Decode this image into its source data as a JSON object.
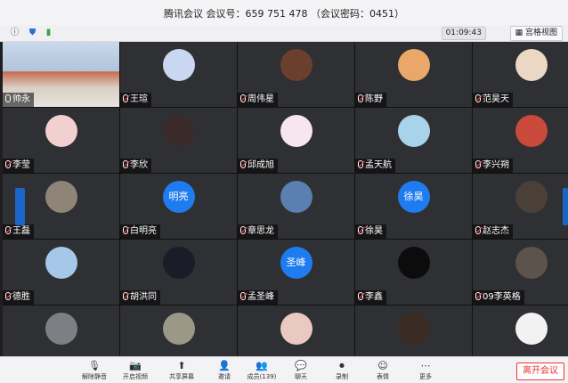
{
  "window": {
    "title": "腾讯会议 会议号：659 751 478 （会议密码：0451）"
  },
  "toolbar": {
    "timer": "01:09:43",
    "view_label": "宫格视图"
  },
  "tiles": [
    {
      "name": "帅永",
      "kind": "video"
    },
    {
      "name": "王瑄",
      "kind": "avatar"
    },
    {
      "name": "周伟星",
      "kind": "avatar"
    },
    {
      "name": "陈野",
      "kind": "avatar"
    },
    {
      "name": "范昊天",
      "kind": "avatar"
    },
    {
      "name": "李莹",
      "kind": "avatar"
    },
    {
      "name": "李欣",
      "kind": "avatar"
    },
    {
      "name": "邱成旭",
      "kind": "avatar"
    },
    {
      "name": "孟天航",
      "kind": "avatar"
    },
    {
      "name": "李兴朔",
      "kind": "avatar"
    },
    {
      "name": "王磊",
      "kind": "avatar"
    },
    {
      "name": "白明亮",
      "kind": "text",
      "avatar_text": "明亮"
    },
    {
      "name": "章思龙",
      "kind": "avatar"
    },
    {
      "name": "徐昊",
      "kind": "text",
      "avatar_text": "徐昊"
    },
    {
      "name": "赵志杰",
      "kind": "avatar"
    },
    {
      "name": "德胜",
      "kind": "avatar"
    },
    {
      "name": "胡洪同",
      "kind": "avatar"
    },
    {
      "name": "孟圣峰",
      "kind": "text",
      "avatar_text": "圣峰"
    },
    {
      "name": "李鑫",
      "kind": "avatar"
    },
    {
      "name": "09李英格",
      "kind": "avatar"
    },
    {
      "name": "",
      "kind": "avatar"
    },
    {
      "name": "",
      "kind": "avatar"
    },
    {
      "name": "",
      "kind": "avatar"
    },
    {
      "name": "",
      "kind": "avatar"
    },
    {
      "name": "",
      "kind": "avatar"
    }
  ],
  "bottom": {
    "items": [
      "解除静音",
      "开启视频",
      "共享屏幕",
      "邀请",
      "成员(139)",
      "聊天",
      "录制",
      "表情",
      "更多"
    ],
    "leave_label": "离开会议"
  }
}
